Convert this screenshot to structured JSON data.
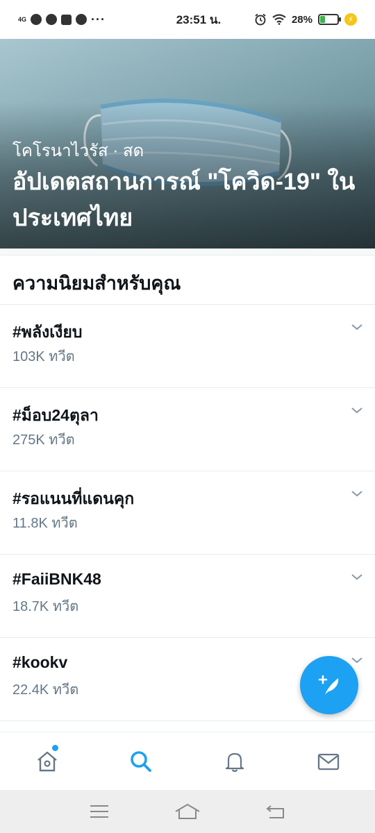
{
  "status_bar": {
    "network": "4G",
    "time": "23:51 น.",
    "battery": "28%",
    "battery_level": 0.28,
    "icons": [
      "network-4g-icon",
      "app-notification-icon",
      "app-notification-icon",
      "facebook-icon",
      "leaf-app-icon",
      "more-icon",
      "alarm-icon",
      "wifi-icon",
      "battery-icon",
      "charging-icon"
    ]
  },
  "hero": {
    "category": "โคโรนาไวรัส · สด",
    "title": "อัปเดตสถานการณ์ \"โควิด-19\" ในประเทศไทย",
    "image": "surgical-mask-photo"
  },
  "section": {
    "title": "ความนิยมสำหรับคุณ"
  },
  "trends": [
    {
      "name": "#พลังเงียบ",
      "count": "103K ทวีต"
    },
    {
      "name": "#ม็อบ24ตุลา",
      "count": "275K ทวีต"
    },
    {
      "name": "#รอแนนที่แดนคุก",
      "count": "11.8K ทวีต"
    },
    {
      "name": "#FaiiBNK48",
      "count": "18.7K ทวีต"
    },
    {
      "name": "#kookv",
      "count": "22.4K ทวีต"
    }
  ],
  "fab": {
    "icon": "compose-tweet-icon"
  },
  "bottom_nav": {
    "tabs": [
      {
        "name": "home",
        "icon": "home-icon",
        "active": false,
        "badge": true
      },
      {
        "name": "search",
        "icon": "search-icon",
        "active": true
      },
      {
        "name": "notifications",
        "icon": "bell-icon",
        "active": false
      },
      {
        "name": "messages",
        "icon": "mail-icon",
        "active": false
      }
    ]
  },
  "colors": {
    "accent": "#1da1f2",
    "text_primary": "#0f1419",
    "text_secondary": "#657786",
    "divider": "#e6ecf0"
  }
}
